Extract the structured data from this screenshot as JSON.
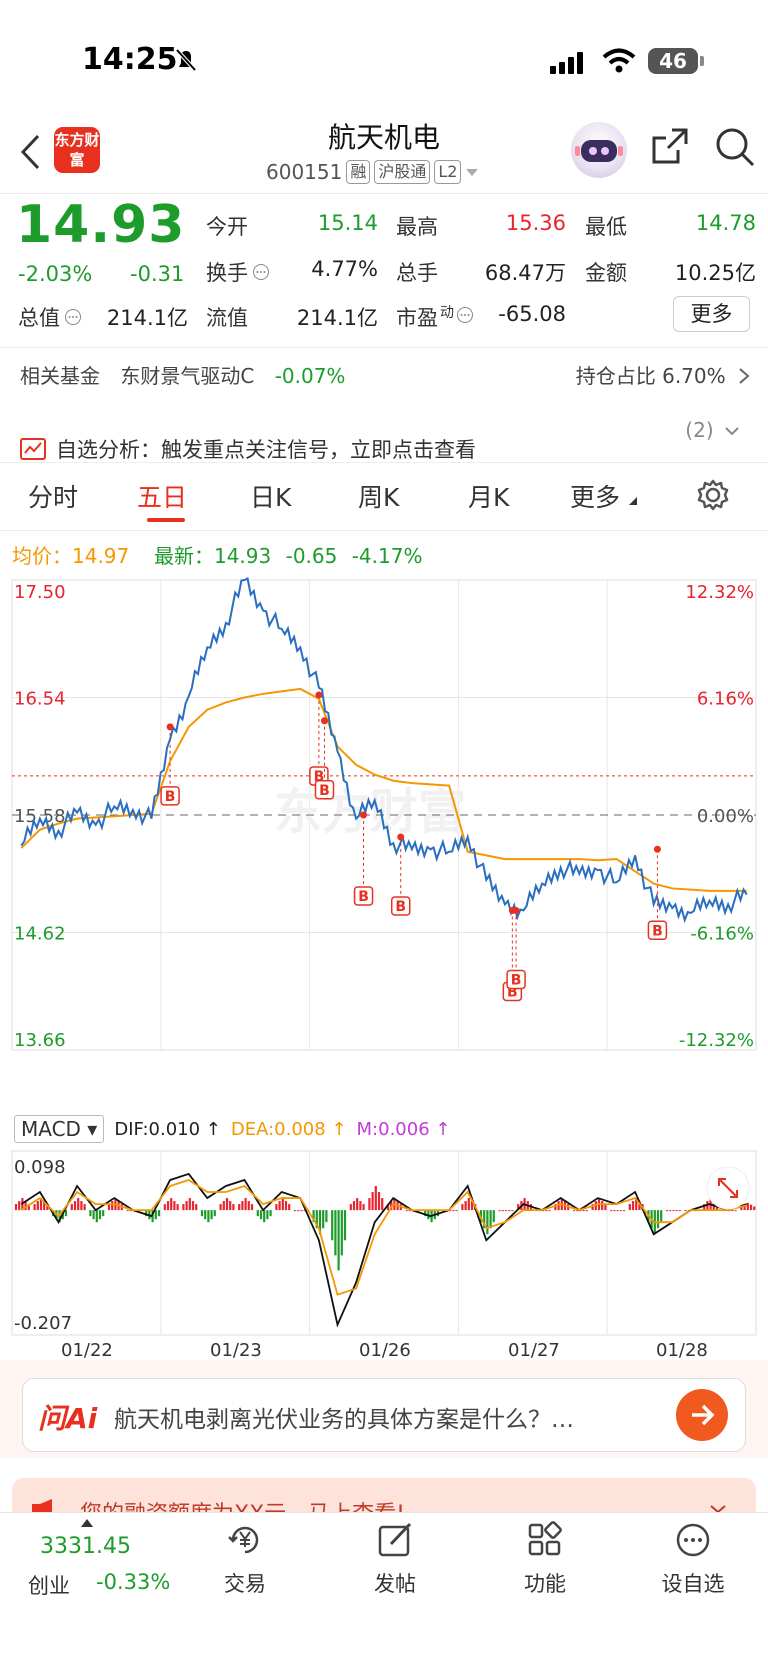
{
  "status": {
    "time": "14:25",
    "battery": "46"
  },
  "header": {
    "logo": "东方财富",
    "name": "航天机电",
    "code": "600151",
    "tags": [
      "融",
      "沪股通",
      "L2"
    ]
  },
  "quote": {
    "price": "14.93",
    "change_pct": "-2.03%",
    "change": "-0.31",
    "open_label": "今开",
    "open": "15.14",
    "high_label": "最高",
    "high": "15.36",
    "low_label": "最低",
    "low": "14.78",
    "turnover_label": "换手",
    "turnover": "4.77%",
    "volume_label": "总手",
    "volume": "68.47万",
    "amount_label": "金额",
    "amount": "10.25亿",
    "mktcap_label": "总值",
    "mktcap": "214.1亿",
    "float_label": "流值",
    "float": "214.1亿",
    "pe_label": "市盈",
    "pe_sup": "动",
    "pe": "-65.08",
    "more": "更多"
  },
  "fund": {
    "label": "相关基金",
    "name": "东财景气驱动C",
    "change": "-0.07%",
    "holding": "持仓占比 6.70%"
  },
  "alert": {
    "text": "自选分析：触发重点关注信号，立即点击查看",
    "count": "(2)"
  },
  "tabs": [
    "分时",
    "五日",
    "日K",
    "周K",
    "月K",
    "更多"
  ],
  "legend": {
    "avg_label": "均价：",
    "avg": "14.97",
    "last_label": "最新：",
    "last": "14.93",
    "chg": "-0.65",
    "chg_pct": "-4.17%"
  },
  "macd": {
    "label": "MACD",
    "dif": "DIF:0.010 ↑",
    "dea": "DEA:0.008 ↑",
    "m": "M:0.006 ↑"
  },
  "chart_data": [
    {
      "type": "line",
      "title": "",
      "x": [
        "01/22",
        "01/23",
        "01/26",
        "01/27",
        "01/28"
      ],
      "y_ticks_left": [
        "17.50",
        "16.54",
        "15.58",
        "14.62",
        "13.66"
      ],
      "y_ticks_right": [
        "12.32%",
        "6.16%",
        "0.00%",
        "-6.16%",
        "-12.32%"
      ],
      "ylim": [
        13.66,
        17.5
      ],
      "prev_close": 15.58,
      "series": [
        {
          "name": "均价",
          "values": [
            15.31,
            15.46,
            15.51,
            15.55,
            15.56,
            15.57,
            15.58,
            15.59,
            16.02,
            16.3,
            16.44,
            16.5,
            16.54,
            16.57,
            16.59,
            16.61,
            16.53,
            16.14,
            15.99,
            15.91,
            15.86,
            15.84,
            15.83,
            15.82,
            15.28,
            15.25,
            15.22,
            15.22,
            15.22,
            15.22,
            15.22,
            15.21,
            15.22,
            15.12,
            15.02,
            14.98,
            14.97,
            14.96,
            14.96,
            14.96
          ]
        },
        {
          "name": "最新",
          "values": [
            15.33,
            15.55,
            15.45,
            15.6,
            15.5,
            15.65,
            15.62,
            15.55,
            16.2,
            16.55,
            16.95,
            17.15,
            17.5,
            17.25,
            17.1,
            16.95,
            16.62,
            16.1,
            15.55,
            15.7,
            15.35,
            15.3,
            15.3,
            15.28,
            15.4,
            15.05,
            14.85,
            14.8,
            15.02,
            15.15,
            15.1,
            15.13,
            15.03,
            15.25,
            14.85,
            14.82,
            14.78,
            14.88,
            14.85,
            14.93
          ]
        }
      ],
      "markers": [
        {
          "label": "B",
          "x": 8,
          "value": 16.3
        },
        {
          "label": "B",
          "x": 16,
          "value": 16.56
        },
        {
          "label": "B",
          "x": 16.3,
          "value": 16.35
        },
        {
          "label": "B",
          "x": 18.4,
          "value": 15.58
        },
        {
          "label": "B",
          "x": 20.4,
          "value": 15.4
        },
        {
          "label": "B",
          "x": 26.4,
          "value": 14.8
        },
        {
          "label": "B",
          "x": 26.6,
          "value": 14.8
        },
        {
          "label": "B",
          "x": 34.2,
          "value": 15.3
        }
      ]
    },
    {
      "type": "bar",
      "title": "MACD",
      "ylim": [
        -0.207,
        0.098
      ],
      "y_ticks": [
        "0.098",
        "-0.207"
      ],
      "series": [
        {
          "name": "DIF",
          "values": [
            0.01,
            0.03,
            -0.02,
            0.04,
            0.0,
            0.02,
            0.0,
            -0.01,
            0.05,
            0.06,
            0.02,
            0.04,
            0.05,
            0.0,
            0.03,
            0.02,
            -0.05,
            -0.19,
            -0.12,
            -0.02,
            0.02,
            0.0,
            -0.01,
            0.0,
            0.04,
            -0.05,
            -0.02,
            0.01,
            0.0,
            0.02,
            0.0,
            0.02,
            0.01,
            0.03,
            -0.04,
            -0.02,
            0.0,
            0.01,
            0.0,
            0.01
          ]
        },
        {
          "name": "DEA",
          "values": [
            0.0,
            0.02,
            -0.01,
            0.03,
            0.01,
            0.01,
            0.0,
            0.0,
            0.04,
            0.05,
            0.03,
            0.03,
            0.04,
            0.01,
            0.02,
            0.02,
            -0.03,
            -0.14,
            -0.13,
            -0.04,
            0.01,
            0.0,
            0.0,
            0.0,
            0.03,
            -0.03,
            -0.02,
            0.0,
            0.0,
            0.01,
            0.0,
            0.01,
            0.01,
            0.02,
            -0.02,
            -0.02,
            0.0,
            0.0,
            0.0,
            0.008
          ]
        },
        {
          "name": "M",
          "values": [
            0.01,
            0.01,
            -0.01,
            0.01,
            -0.01,
            0.01,
            0.0,
            -0.01,
            0.01,
            0.01,
            -0.01,
            0.01,
            0.01,
            -0.01,
            0.01,
            0.0,
            -0.02,
            -0.05,
            0.01,
            0.02,
            0.01,
            0.0,
            -0.01,
            0.0,
            0.01,
            -0.02,
            0.0,
            0.01,
            0.0,
            0.01,
            0.0,
            0.01,
            0.0,
            0.01,
            -0.02,
            0.0,
            0.0,
            0.01,
            0.0,
            0.006
          ]
        }
      ],
      "colors": {
        "up": "#e8242f",
        "down": "#1d9c2c",
        "dif": "#111111",
        "dea": "#f39800"
      }
    }
  ],
  "ai": {
    "brand": "问Ai",
    "question": "航天机电剥离光伏业务的具体方案是什么？…"
  },
  "promo": {
    "text": "您的融资额度为XX元，马上查看!"
  },
  "nav": {
    "index_value": "3331.45",
    "index_name": "创业",
    "index_change": "-0.33%",
    "items": [
      "交易",
      "发帖",
      "功能",
      "设自选"
    ]
  },
  "colors": {
    "up": "#e8242f",
    "down": "#1d9c2c",
    "avg": "#f39800",
    "price_line": "#2a6fbf",
    "accent": "#e8301f"
  }
}
